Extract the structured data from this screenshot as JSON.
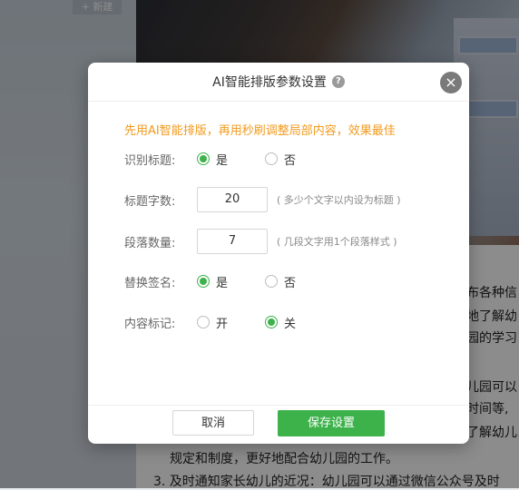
{
  "background": {
    "ghost_button": "+ 新建",
    "doc_lines": [
      "布各种信",
      "地了解幼",
      "园的学习",
      "儿园可以",
      "时间等,",
      "了解幼儿",
      "规定和制度，更好地配合幼儿园的工作。",
      "3. 及时通知家长幼儿的近况：幼儿园可以通过微信公众号及时"
    ]
  },
  "dialog": {
    "title": "AI智能排版参数设置",
    "help_icon": "?",
    "close_icon": "×",
    "tip": "先用AI智能排版，再用秒刷调整局部内容，效果最佳",
    "rows": {
      "recognize_title": {
        "label": "识别标题:",
        "option_yes": "是",
        "option_no": "否",
        "selected": "yes"
      },
      "title_chars": {
        "label": "标题字数:",
        "value": "20",
        "hint": "( 多少个文字以内设为标题 )"
      },
      "paragraph_count": {
        "label": "段落数量:",
        "value": "7",
        "hint": "( 几段文字用1个段落样式 )"
      },
      "replace_signature": {
        "label": "替换签名:",
        "option_yes": "是",
        "option_no": "否",
        "selected": "yes"
      },
      "content_mark": {
        "label": "内容标记:",
        "option_on": "开",
        "option_off": "关",
        "selected": "off"
      }
    },
    "cancel_label": "取消",
    "save_label": "保存设置"
  },
  "colors": {
    "accent": "#3db24b",
    "tip": "#f29a1d"
  }
}
